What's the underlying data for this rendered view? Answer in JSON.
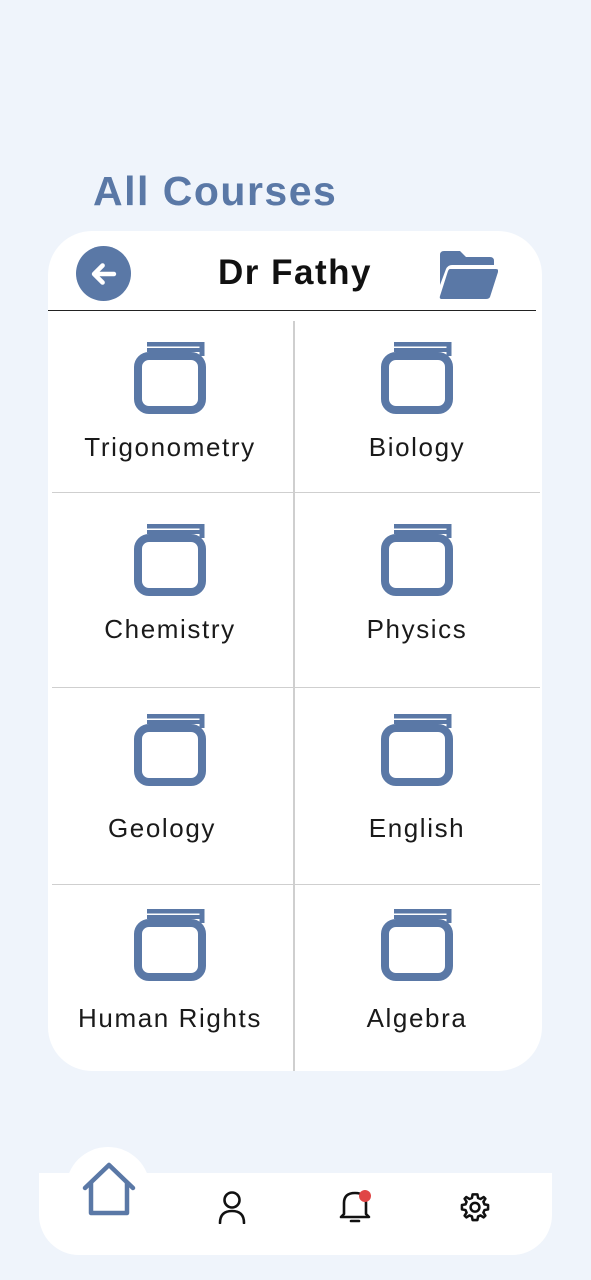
{
  "page": {
    "title": "All Courses"
  },
  "header": {
    "teacher_name": "Dr Fathy",
    "back_icon": "arrow-left-icon",
    "folder_icon": "folder-open-icon"
  },
  "courses": [
    {
      "label": "Trigonometry",
      "icon": "book-icon"
    },
    {
      "label": "Biology",
      "icon": "book-icon"
    },
    {
      "label": "Chemistry",
      "icon": "book-icon"
    },
    {
      "label": "Physics",
      "icon": "book-icon"
    },
    {
      "label": "Geology",
      "icon": "book-icon"
    },
    {
      "label": "English",
      "icon": "book-icon"
    },
    {
      "label": "Human Rights",
      "icon": "book-icon"
    },
    {
      "label": "Algebra",
      "icon": "book-icon"
    }
  ],
  "nav": {
    "items": [
      {
        "id": "home",
        "icon": "home-icon",
        "active": true
      },
      {
        "id": "profile",
        "icon": "user-icon",
        "active": false
      },
      {
        "id": "notifications",
        "icon": "bell-icon",
        "active": false,
        "badge": true
      },
      {
        "id": "settings",
        "icon": "gear-icon",
        "active": false
      }
    ]
  },
  "colors": {
    "accent": "#5a78a6",
    "background": "#eff4fb",
    "badge": "#e04646"
  }
}
